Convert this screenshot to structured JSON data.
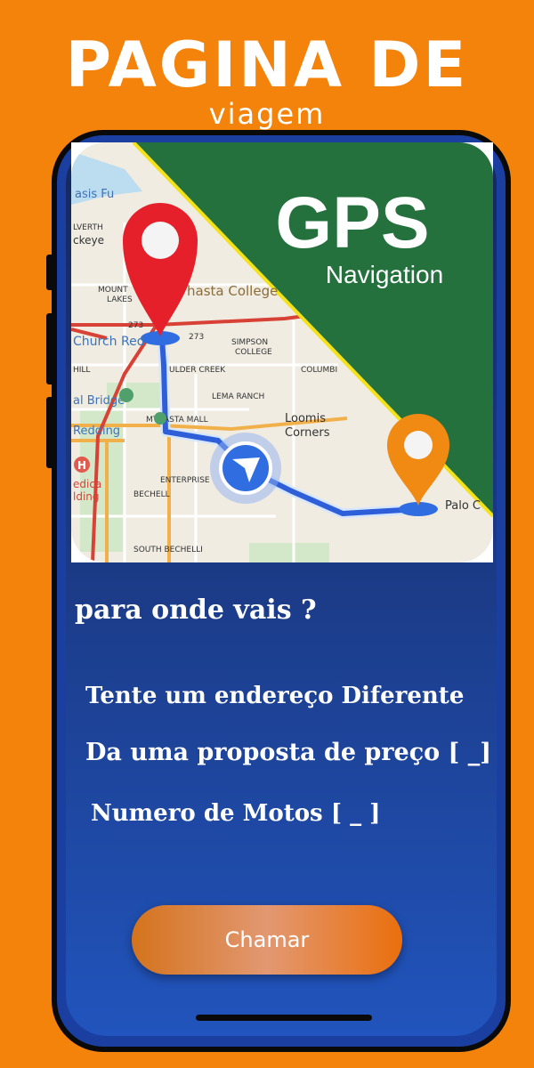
{
  "header": {
    "title": "PAGINA DE",
    "subtitle": "viagem"
  },
  "map_image": {
    "heading": "GPS",
    "subheading": "Navigation",
    "places": [
      "asis Fu",
      "LVERTH",
      "ckeye",
      "MOUNT",
      "LAKES",
      "hasta College",
      "273",
      "273",
      "SIMPSON",
      "COLLEGE",
      "Church Red",
      "HILL",
      "ULDER CREEK",
      "COLUMBI",
      "LEMA RANCH",
      "al Bridge",
      "Redding",
      "MT",
      "ASTA MALL",
      "Loomis",
      "Corners",
      "ENTERPRISE",
      "edica",
      "lding",
      "BECHELL",
      "SOUTH BECHELLI",
      "Palo C"
    ],
    "colors": {
      "green": "#24713e",
      "pin_red": "#e5202b",
      "pin_orange": "#f18a12",
      "route": "#2f5fd8"
    }
  },
  "form": {
    "question": "para onde vais ?",
    "option_address": "Tente um endereço Diferente",
    "option_price": "Da uma proposta de preço [ _]",
    "option_motos": "Numero de Motos [  _ ]"
  },
  "actions": {
    "call_label": "Chamar"
  },
  "colors": {
    "background": "#f4830b",
    "screen_top": "#15285e",
    "screen_bottom": "#2154bc"
  }
}
